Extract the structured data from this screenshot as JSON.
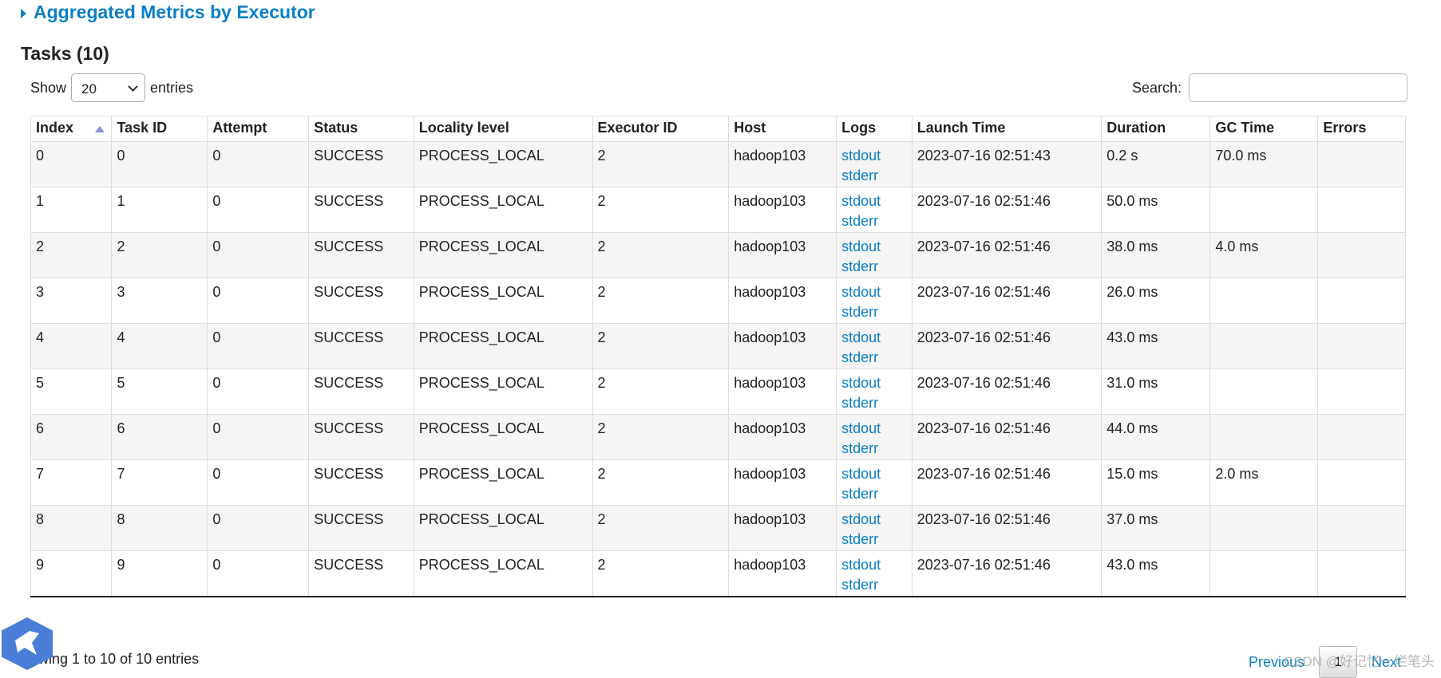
{
  "section": {
    "label": "Aggregated Metrics by Executor"
  },
  "tasks_title": "Tasks (10)",
  "length_control": {
    "show_label": "Show",
    "value": "20",
    "entries_label": "entries"
  },
  "search": {
    "label": "Search:",
    "value": ""
  },
  "table": {
    "headers": [
      "Index",
      "Task ID",
      "Attempt",
      "Status",
      "Locality level",
      "Executor ID",
      "Host",
      "Logs",
      "Launch Time",
      "Duration",
      "GC Time",
      "Errors"
    ],
    "sort": {
      "column": "Index",
      "direction": "ascending"
    },
    "rows": [
      [
        "0",
        "0",
        "0",
        "SUCCESS",
        "PROCESS_LOCAL",
        "2",
        "hadoop103",
        "stdout",
        "stderr",
        "2023-07-16 02:51:43",
        "0.2 s",
        "70.0 ms",
        ""
      ],
      [
        "1",
        "1",
        "0",
        "SUCCESS",
        "PROCESS_LOCAL",
        "2",
        "hadoop103",
        "stdout",
        "stderr",
        "2023-07-16 02:51:46",
        "50.0 ms",
        "",
        ""
      ],
      [
        "2",
        "2",
        "0",
        "SUCCESS",
        "PROCESS_LOCAL",
        "2",
        "hadoop103",
        "stdout",
        "stderr",
        "2023-07-16 02:51:46",
        "38.0 ms",
        "4.0 ms",
        ""
      ],
      [
        "3",
        "3",
        "0",
        "SUCCESS",
        "PROCESS_LOCAL",
        "2",
        "hadoop103",
        "stdout",
        "stderr",
        "2023-07-16 02:51:46",
        "26.0 ms",
        "",
        ""
      ],
      [
        "4",
        "4",
        "0",
        "SUCCESS",
        "PROCESS_LOCAL",
        "2",
        "hadoop103",
        "stdout",
        "stderr",
        "2023-07-16 02:51:46",
        "43.0 ms",
        "",
        ""
      ],
      [
        "5",
        "5",
        "0",
        "SUCCESS",
        "PROCESS_LOCAL",
        "2",
        "hadoop103",
        "stdout",
        "stderr",
        "2023-07-16 02:51:46",
        "31.0 ms",
        "",
        ""
      ],
      [
        "6",
        "6",
        "0",
        "SUCCESS",
        "PROCESS_LOCAL",
        "2",
        "hadoop103",
        "stdout",
        "stderr",
        "2023-07-16 02:51:46",
        "44.0 ms",
        "",
        ""
      ],
      [
        "7",
        "7",
        "0",
        "SUCCESS",
        "PROCESS_LOCAL",
        "2",
        "hadoop103",
        "stdout",
        "stderr",
        "2023-07-16 02:51:46",
        "15.0 ms",
        "2.0 ms",
        ""
      ],
      [
        "8",
        "8",
        "0",
        "SUCCESS",
        "PROCESS_LOCAL",
        "2",
        "hadoop103",
        "stdout",
        "stderr",
        "2023-07-16 02:51:46",
        "37.0 ms",
        "",
        ""
      ],
      [
        "9",
        "9",
        "0",
        "SUCCESS",
        "PROCESS_LOCAL",
        "2",
        "hadoop103",
        "stdout",
        "stderr",
        "2023-07-16 02:51:46",
        "43.0 ms",
        "",
        ""
      ]
    ]
  },
  "info": "owing 1 to 10 of 10 entries",
  "pagination": {
    "previous": "Previous",
    "current": "1",
    "next": "Next"
  },
  "watermark": "CSDN @好记忆一烂笔头",
  "colors": {
    "link": "#0b7fc7",
    "stripe": "#f5f5f5",
    "sort_arrow": "#8a8fd8"
  }
}
